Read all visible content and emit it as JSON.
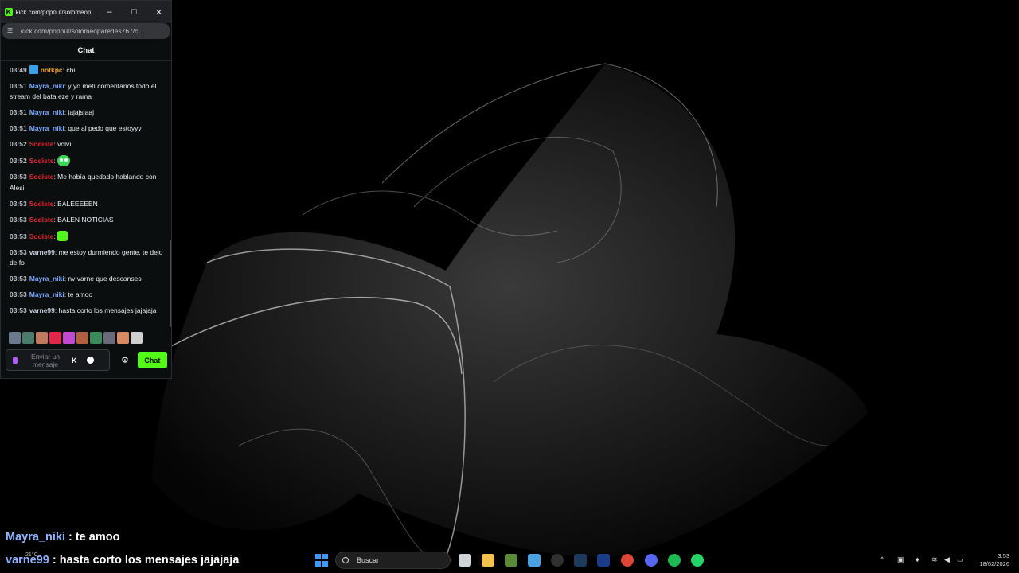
{
  "window": {
    "title": "kick.com/popout/solomeop...",
    "url": "kick.com/popout/solomeoparedes767/c...",
    "chat_header": "Chat"
  },
  "messages": [
    {
      "time": "03:49",
      "user": "notkpc",
      "user_color": "#f5a623",
      "badge": true,
      "text": ": chi"
    },
    {
      "time": "03:51",
      "user": "Mayra_niki",
      "user_color": "#7aa7ff",
      "text": ": y yo metí comentarios todo el stream del bata eze y rama"
    },
    {
      "time": "03:51",
      "user": "Mayra_niki",
      "user_color": "#7aa7ff",
      "text": ": jajajsjaaj"
    },
    {
      "time": "03:51",
      "user": "Mayra_niki",
      "user_color": "#7aa7ff",
      "text": ": que al pedo que estoyyy"
    },
    {
      "time": "03:52",
      "user": "Sodiste",
      "user_color": "#e02e3a",
      "text": ": volví"
    },
    {
      "time": "03:52",
      "user": "Sodiste",
      "user_color": "#e02e3a",
      "text": ": ",
      "emote": "ghost"
    },
    {
      "time": "03:53",
      "user": "Sodiste",
      "user_color": "#e02e3a",
      "text": ": Me había quedado hablando con Alesi"
    },
    {
      "time": "03:53",
      "user": "Sodiste",
      "user_color": "#e02e3a",
      "text": ": BALEEEEEN"
    },
    {
      "time": "03:53",
      "user": "Sodiste",
      "user_color": "#e02e3a",
      "text": ": BALEN NOTICIAS"
    },
    {
      "time": "03:53",
      "user": "Sodiste",
      "user_color": "#e02e3a",
      "text": ": ",
      "emote": "green"
    },
    {
      "time": "03:53",
      "user": "varne99",
      "user_color": "#c8d1e0",
      "text": ": me estoy durmiendo gente, te dejo de fo"
    },
    {
      "time": "03:53",
      "user": "Mayra_niki",
      "user_color": "#7aa7ff",
      "text": ": nv varne que descanses"
    },
    {
      "time": "03:53",
      "user": "Mayra_niki",
      "user_color": "#7aa7ff",
      "text": ": te amoo"
    },
    {
      "time": "03:53",
      "user": "varne99",
      "user_color": "#c8d1e0",
      "text": ": hasta corto los mensajes jajajaja"
    }
  ],
  "composer": {
    "placeholder": "Enviar un mensaje",
    "send_label": "Chat"
  },
  "overlay": {
    "line1_user": "Mayra_niki",
    "line1_text": " : te amoo",
    "line2_user": "varne99",
    "line2_text": " : hasta corto los mensajes jajajaja"
  },
  "taskbar": {
    "weather": "21°C",
    "search_placeholder": "Buscar",
    "time": "3:53",
    "date": "18/02/2026"
  }
}
